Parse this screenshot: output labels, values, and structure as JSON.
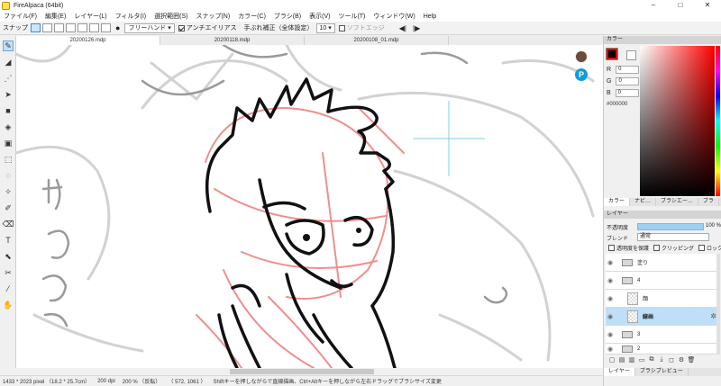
{
  "window": {
    "title": "FireAlpaca (64bit)",
    "minimize": "–",
    "maximize": "□",
    "close": "✕"
  },
  "menu": [
    "ファイル(F)",
    "編集(E)",
    "レイヤー(L)",
    "フィルタ(I)",
    "選択範囲(S)",
    "スナップ(N)",
    "カラー(C)",
    "ブラシ(B)",
    "表示(V)",
    "ツール(T)",
    "ウィンドウ(W)",
    "Help"
  ],
  "toolbar": {
    "snap_label": "スナップ",
    "brush_mode": "フリーハンド",
    "antialias_label": "アンチエイリアス",
    "stabilizer_label": "手ぶれ補正（全体設定）",
    "stabilizer_value": "10",
    "soft_edge_label": "ソフトエッジ"
  },
  "tabs": [
    {
      "label": "20200126.mdp",
      "active": true
    },
    {
      "label": "20200118.mdp",
      "active": false
    },
    {
      "label": "20200108_01.mdp",
      "active": false
    }
  ],
  "color_panel": {
    "title": "カラー",
    "r_label": "R",
    "r_value": "0",
    "g_label": "G",
    "g_value": "0",
    "b_label": "B",
    "b_value": "0",
    "hex": "#000000",
    "foreground": "#000000",
    "background": "#ffffff",
    "tabs": [
      "カラー",
      "ナビ…",
      "ブラシエー…",
      "ブラ"
    ]
  },
  "layer_panel": {
    "title": "レイヤー",
    "opacity_label": "不透明度",
    "opacity_value": "100 %",
    "opacity_fraction": 1.0,
    "blend_label": "ブレンド",
    "blend_value": "通常",
    "protect_alpha_label": "透明度を保護",
    "clipping_label": "クリッピング",
    "lock_label": "ロック",
    "layers": [
      {
        "name": "塗り",
        "type": "folder",
        "selected": false
      },
      {
        "name": "4",
        "type": "folder",
        "selected": false
      },
      {
        "name": "顔",
        "type": "layer",
        "selected": false
      },
      {
        "name": "線画",
        "type": "layer",
        "selected": true
      },
      {
        "name": "3",
        "type": "folder",
        "selected": false
      },
      {
        "name": "2",
        "type": "folder",
        "selected": false
      }
    ],
    "bottom_tabs": [
      "レイヤー",
      "ブラシプレビュー"
    ]
  },
  "status": {
    "size": "1433 * 2023 pixel （18.2 * 25.7cm）",
    "dpi": "200 dpi",
    "zoom": "200 % （反転）",
    "coords": "（ 572, 1061 ）",
    "hint": "Shiftキーを押しながらで直線描画、Ctrl+Altキーを押しながら左右ドラッグでブラシサイズ変更"
  }
}
